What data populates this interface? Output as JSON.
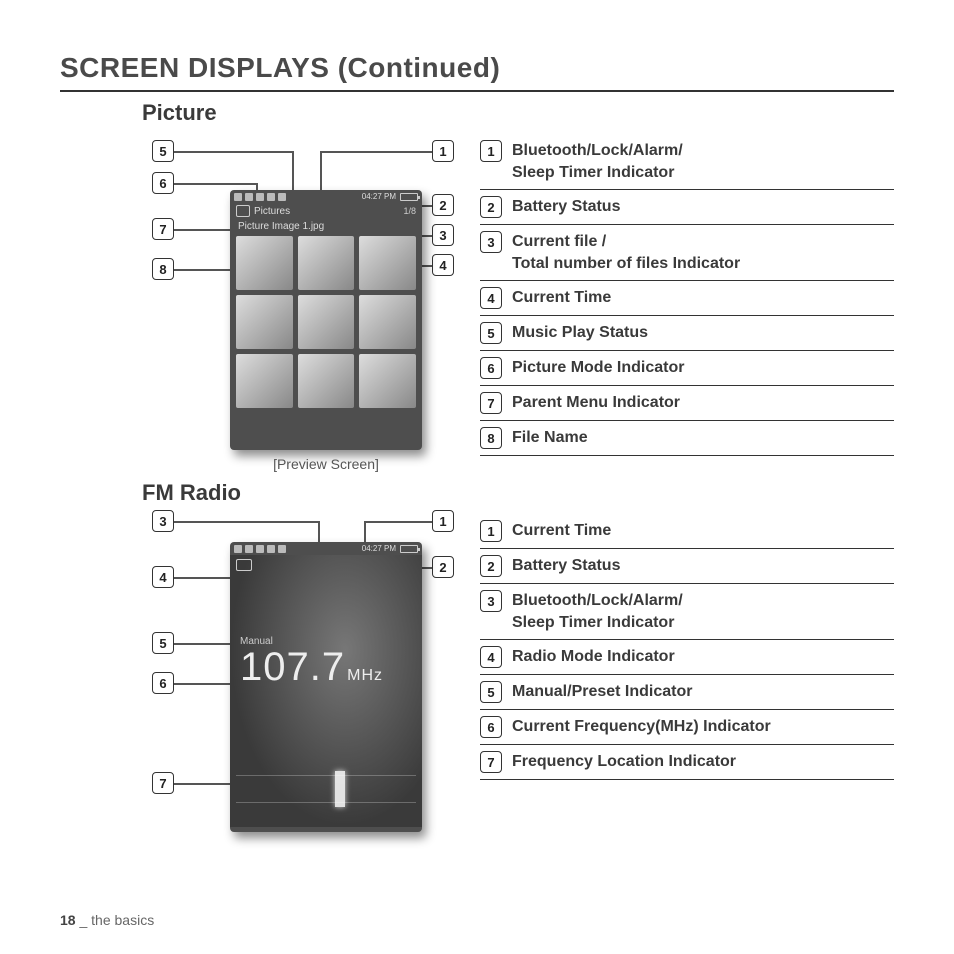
{
  "page": {
    "title": "SCREEN DISPLAYS (Continued)",
    "footer_page": "18",
    "footer_sep": " _ ",
    "footer_section": "the basics"
  },
  "picture": {
    "title": "Picture",
    "device": {
      "menu_label": "Pictures",
      "counter": "1/8",
      "filename": "Picture Image 1.jpg",
      "time": "04:27 PM"
    },
    "caption": "[Preview Screen]",
    "legend": [
      {
        "n": "1",
        "label": "Bluetooth/Lock/Alarm/\nSleep Timer Indicator"
      },
      {
        "n": "2",
        "label": "Battery Status"
      },
      {
        "n": "3",
        "label": "Current file /\nTotal number of files Indicator"
      },
      {
        "n": "4",
        "label": "Current Time"
      },
      {
        "n": "5",
        "label": "Music Play Status"
      },
      {
        "n": "6",
        "label": "Picture Mode Indicator"
      },
      {
        "n": "7",
        "label": "Parent Menu Indicator"
      },
      {
        "n": "8",
        "label": "File Name"
      }
    ]
  },
  "radio": {
    "title": "FM Radio",
    "device": {
      "mode": "Manual",
      "frequency": "107.7",
      "unit": "MHz",
      "time": "04:27 PM"
    },
    "legend": [
      {
        "n": "1",
        "label": "Current Time"
      },
      {
        "n": "2",
        "label": "Battery Status"
      },
      {
        "n": "3",
        "label": "Bluetooth/Lock/Alarm/\nSleep Timer Indicator"
      },
      {
        "n": "4",
        "label": "Radio Mode Indicator"
      },
      {
        "n": "5",
        "label": "Manual/Preset Indicator"
      },
      {
        "n": "6",
        "label": "Current Frequency(MHz) Indicator"
      },
      {
        "n": "7",
        "label": "Frequency Location Indicator"
      }
    ]
  }
}
